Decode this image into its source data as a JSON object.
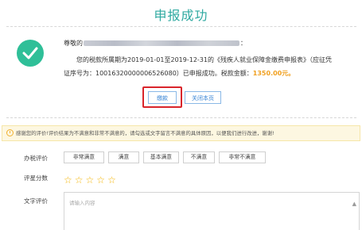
{
  "page": {
    "title": "申报成功"
  },
  "result": {
    "greeting_prefix": "尊敬的",
    "greeting_suffix": "：",
    "message_line1": "您的税款所属期为2019-01-01至2019-12-31的《残疾人就业保障金缴费申报表》（应征凭",
    "message_line2_prefix": "证序号为：10016320000006526080）已申报成功。税款金额：",
    "amount": "1350.00",
    "amount_unit": "元。",
    "success_icon": "check-icon",
    "success_color": "#2fbf98"
  },
  "actions": {
    "pay_label": "缴款",
    "close_label": "关闭本页",
    "highlight_color": "#d9252b"
  },
  "notice": {
    "icon": "warning-icon",
    "text": "感谢您的评价!评价结果为不满意和非常不满意的，请勾选或文字留言不满意的具体原因，以便我们进行改进，谢谢!"
  },
  "evaluation": {
    "label": "办税评价",
    "options": [
      "非常满意",
      "满意",
      "基本满意",
      "不满意",
      "非常不满意"
    ]
  },
  "rating": {
    "label": "评星分数",
    "stars": 5,
    "star_char": "☆",
    "star_color": "#f4b400"
  },
  "comment": {
    "label": "文字评价",
    "placeholder": "请输入内容"
  }
}
